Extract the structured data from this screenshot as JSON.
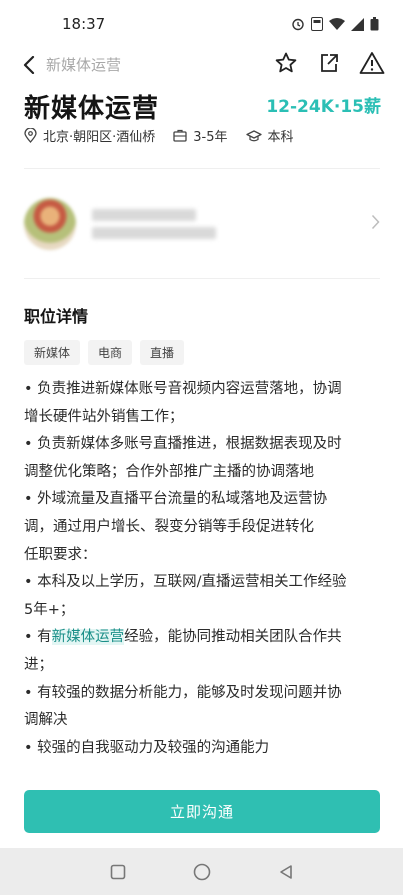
{
  "status_bar": {
    "time": "18:37",
    "icons": [
      "alarm-icon",
      "hd-icon",
      "wifi-icon",
      "signal-icon",
      "battery-icon"
    ]
  },
  "nav": {
    "title": "新媒体运营",
    "icons": [
      "back-arrow-icon",
      "star-icon",
      "share-icon",
      "report-icon"
    ]
  },
  "job": {
    "title": "新媒体运营",
    "salary": "12-24K·15薪",
    "location": "北京·朝阳区·酒仙桥",
    "experience": "3-5年",
    "education": "本科"
  },
  "section_title": "职位详情",
  "tags": [
    "新媒体",
    "电商",
    "直播"
  ],
  "description": [
    "• 负责推进新媒体账号音视频内容运营落地，协调",
    "增长硬件站外销售工作；",
    " • 负责新媒体多账号直播推进，根据数据表现及时",
    "调整优化策略；合作外部推广主播的协调落地 ",
    " • 外域流量及直播平台流量的私域落地及运营协",
    "调，通过用户增长、裂变分销等手段促进转化 ",
    "任职要求：",
    " • 本科及以上学历，互联网/直播运营相关工作经验",
    "5年+； ",
    " • 有新媒体运营经验，能协同推动相关团队合作共",
    "进； ",
    " • 有较强的数据分析能力，能够及时发现问题并协",
    "调解决 ",
    " • 较强的自我驱动力及较强的沟通能力"
  ],
  "highlight": {
    "before": " • 有",
    "keyword": "新媒体运营",
    "after": "经验，能协同推动相关团队合作共"
  },
  "chat_button": "立即沟通",
  "colors": {
    "accent": "#2fbfb2",
    "salary": "#2bbfb5"
  }
}
